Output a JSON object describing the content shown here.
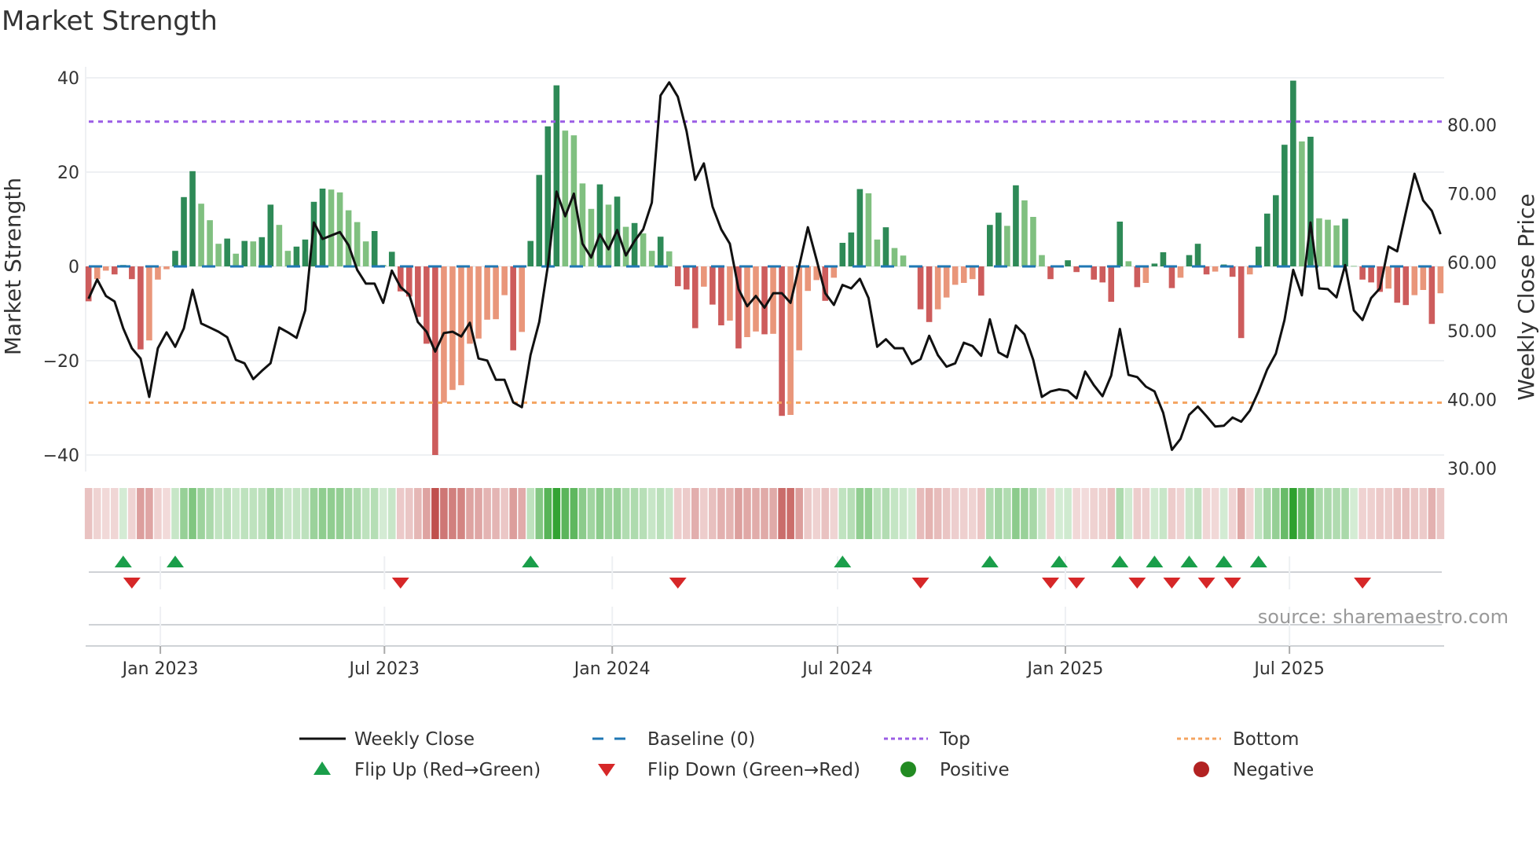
{
  "chart_data": {
    "type": "bar+line",
    "title": "Market Strength",
    "ylabel_left": "Market Strength",
    "ylabel_right": "Weekly Close Price",
    "x_start": "2022-11-04",
    "x_step_days": 7,
    "ylim_left": [
      -42,
      42
    ],
    "yticks_left": [
      40,
      20,
      0,
      -20,
      -40
    ],
    "ytick_labels_left": [
      "40",
      "20",
      "0",
      "−20",
      "−40"
    ],
    "ylim_right": [
      30,
      90
    ],
    "yticks_right": [
      80,
      70,
      60,
      50,
      40,
      30
    ],
    "ytick_labels_right": [
      "80.00",
      "70.00",
      "60.00",
      "50.00",
      "40.00",
      "30.00"
    ],
    "xticks": [
      {
        "date": "2023-01-01",
        "label": "Jan 2023"
      },
      {
        "date": "2023-07-01",
        "label": "Jul 2023"
      },
      {
        "date": "2024-01-01",
        "label": "Jan 2024"
      },
      {
        "date": "2024-07-01",
        "label": "Jul 2024"
      },
      {
        "date": "2025-01-01",
        "label": "Jan 2025"
      },
      {
        "date": "2025-07-01",
        "label": "Jul 2025"
      }
    ],
    "top_level": 30.7,
    "bottom_level": -28.9,
    "baseline": 0,
    "strength": [
      -7.4,
      -2.7,
      -0.9,
      -1.7,
      0.3,
      -2.7,
      -17.6,
      -15.7,
      -2.8,
      -0.6,
      3.3,
      14.7,
      20.2,
      13.3,
      9.8,
      4.8,
      5.9,
      2.7,
      5.4,
      5.3,
      6.2,
      13.1,
      8.8,
      3.3,
      4.2,
      5.7,
      13.7,
      16.5,
      16.3,
      15.7,
      11.9,
      9.4,
      5.3,
      7.5,
      0.3,
      3.1,
      -5.3,
      -6.4,
      -10.7,
      -16.4,
      -40,
      -28.9,
      -26.2,
      -25.2,
      -16.4,
      -15.3,
      -11.3,
      -11.2,
      -6.1,
      -17.8,
      -13.9,
      5.4,
      19.4,
      29.7,
      38.4,
      28.8,
      27.8,
      17.6,
      12.2,
      17.4,
      13.1,
      14.8,
      8.4,
      9.2,
      7.0,
      3.3,
      6.3,
      3.2,
      -4.2,
      -4.9,
      -13.1,
      -4.3,
      -8.1,
      -12.5,
      -11.5,
      -17.4,
      -15.0,
      -13.8,
      -14.4,
      -14.3,
      -31.7,
      -31.5,
      -17.8,
      -5.2,
      -2.9,
      -7.3,
      -2.4,
      5.0,
      7.2,
      16.4,
      15.5,
      5.7,
      8.3,
      3.9,
      2.3,
      0.2,
      -9.1,
      -11.8,
      -9.1,
      -6.6,
      -3.9,
      -3.5,
      -2.7,
      -6.2,
      8.8,
      11.4,
      8.6,
      17.2,
      14.0,
      10.5,
      2.4,
      -2.7,
      0.2,
      1.3,
      -1.2,
      -0.2,
      -2.8,
      -3.4,
      -7.5,
      9.5,
      1.1,
      -4.4,
      -3.5,
      0.6,
      3.0,
      -4.6,
      -2.4,
      2.4,
      4.8,
      -1.7,
      -1.1,
      0.4,
      -2.2,
      -15.2,
      -1.7,
      4.2,
      11.2,
      15.1,
      25.8,
      39.4,
      26.5,
      27.5,
      10.2,
      9.9,
      8.7,
      10.1,
      0.1,
      -2.8,
      -3.4,
      -5.4,
      -4.7,
      -7.7,
      -8.2,
      -6.1,
      -5.0,
      -12.2,
      -5.7
    ],
    "weekly_close": [
      54.7,
      57.5,
      55.1,
      54.3,
      50.4,
      47.5,
      46.0,
      40.4,
      47.5,
      49.8,
      47.7,
      50.4,
      56.0,
      51.1,
      50.5,
      49.9,
      49.1,
      45.8,
      45.3,
      43.0,
      44.2,
      45.3,
      50.5,
      49.8,
      49.0,
      53.0,
      65.8,
      63.4,
      63.9,
      64.4,
      62.5,
      58.9,
      56.9,
      56.9,
      54.1,
      58.8,
      56.4,
      55.3,
      51.3,
      49.9,
      47.0,
      49.7,
      49.9,
      49.2,
      51.2,
      46.0,
      45.7,
      42.9,
      42.9,
      39.6,
      38.9,
      46.5,
      51.3,
      59.5,
      70.3,
      66.7,
      70.0,
      62.7,
      60.7,
      64.1,
      61.9,
      64.7,
      61.0,
      63.1,
      64.8,
      68.7,
      84.3,
      86.2,
      84.1,
      79.1,
      72.0,
      74.4,
      68.1,
      64.8,
      62.7,
      56.1,
      53.6,
      55.1,
      53.4,
      55.5,
      55.5,
      54.1,
      59.5,
      65.1,
      60.4,
      55.5,
      53.8,
      56.7,
      56.2,
      57.6,
      54.8,
      47.7,
      48.8,
      47.5,
      47.5,
      45.2,
      45.9,
      49.3,
      46.5,
      44.8,
      45.3,
      48.3,
      47.8,
      46.4,
      51.7,
      46.9,
      46.2,
      50.8,
      49.5,
      45.8,
      40.4,
      41.2,
      41.5,
      41.3,
      40.2,
      44.1,
      42.1,
      40.5,
      43.5,
      50.3,
      43.6,
      43.3,
      41.9,
      41.2,
      38.1,
      32.7,
      34.3,
      37.8,
      39.0,
      37.6,
      36.1,
      36.2,
      37.4,
      36.8,
      38.4,
      41.2,
      44.4,
      46.7,
      51.6,
      58.9,
      55.2,
      65.8,
      56.2,
      56.1,
      54.9,
      59.6,
      53.0,
      51.6,
      54.8,
      56.2,
      62.3,
      61.6,
      67.3,
      72.9,
      69.0,
      67.5,
      64.1
    ],
    "flip_up_weeks": [
      4,
      10,
      51,
      87,
      104,
      112,
      119,
      123,
      127,
      131,
      135
    ],
    "flip_down_weeks": [
      5,
      36,
      68,
      96,
      111,
      114,
      121,
      125,
      129,
      132,
      147
    ],
    "legend_placement": "bottom-center",
    "legend": {
      "weekly_close": "Weekly Close",
      "baseline": "Baseline (0)",
      "top": "Top",
      "bottom": "Bottom",
      "flip_up": "Flip Up (Red→Green)",
      "flip_down": "Flip Down (Green→Red)",
      "positive": "Positive",
      "negative": "Negative"
    },
    "source": "source: sharemaestro.com",
    "colors": {
      "pos_strong": "#2e8a57",
      "pos_weak": "#80c080",
      "neg_strong": "#cd5c5c",
      "neg_weak": "#e9967a",
      "line": "#111111",
      "baseline": "#1f77b4",
      "top": "#9b5de5",
      "bottom": "#f4a460",
      "flip_up": "#1a9e4a",
      "flip_down": "#d62728",
      "positive": "#228b22",
      "negative": "#b22222",
      "heat_pos": "#2ca02c",
      "heat_neg": "#c0504d"
    }
  }
}
